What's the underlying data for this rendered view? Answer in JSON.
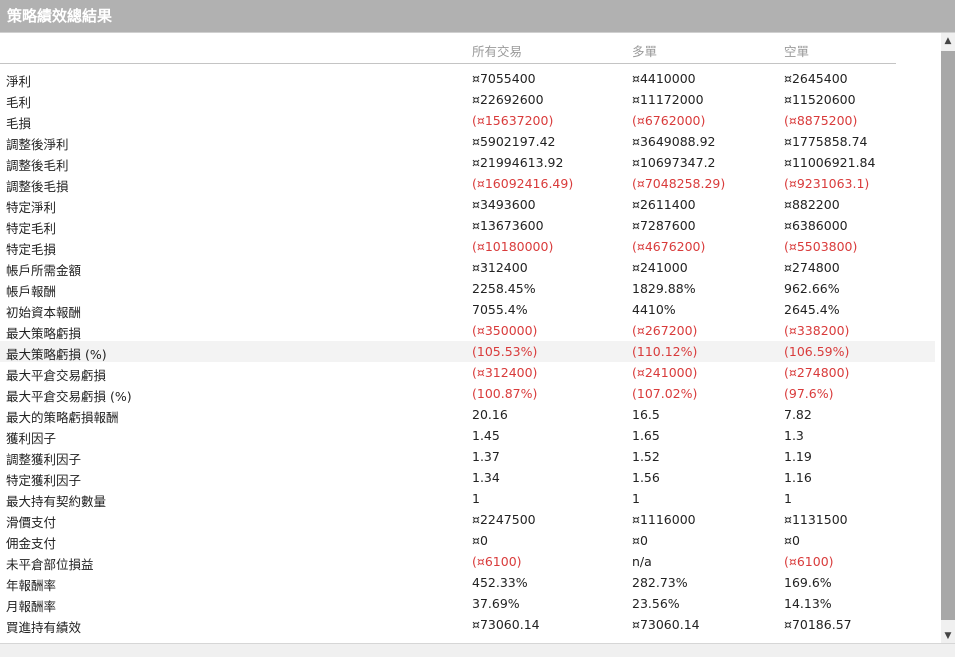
{
  "title": "策略績效總結果",
  "headers": [
    "所有交易",
    "多單",
    "空單"
  ],
  "rows": [
    {
      "label": "淨利",
      "v": [
        "¤7055400",
        "¤4410000",
        "¤2645400"
      ]
    },
    {
      "label": "毛利",
      "v": [
        "¤22692600",
        "¤11172000",
        "¤11520600"
      ]
    },
    {
      "label": "毛損",
      "v": [
        "(¤15637200)",
        "(¤6762000)",
        "(¤8875200)"
      ]
    },
    {
      "label": "調整後淨利",
      "v": [
        "¤5902197.42",
        "¤3649088.92",
        "¤1775858.74"
      ]
    },
    {
      "label": "調整後毛利",
      "v": [
        "¤21994613.92",
        "¤10697347.2",
        "¤11006921.84"
      ]
    },
    {
      "label": "調整後毛損",
      "v": [
        "(¤16092416.49)",
        "(¤7048258.29)",
        "(¤9231063.1)"
      ]
    },
    {
      "label": "特定淨利",
      "v": [
        "¤3493600",
        "¤2611400",
        "¤882200"
      ]
    },
    {
      "label": "特定毛利",
      "v": [
        "¤13673600",
        "¤7287600",
        "¤6386000"
      ]
    },
    {
      "label": "特定毛損",
      "v": [
        "(¤10180000)",
        "(¤4676200)",
        "(¤5503800)"
      ]
    },
    {
      "label": "帳戶所需金額",
      "v": [
        "¤312400",
        "¤241000",
        "¤274800"
      ]
    },
    {
      "label": "帳戶報酬",
      "v": [
        "2258.45%",
        "1829.88%",
        "962.66%"
      ]
    },
    {
      "label": "初始資本報酬",
      "v": [
        "7055.4%",
        "4410%",
        "2645.4%"
      ]
    },
    {
      "label": "最大策略虧損",
      "v": [
        "(¤350000)",
        "(¤267200)",
        "(¤338200)"
      ]
    },
    {
      "label": "最大策略虧損 (%)",
      "v": [
        "(105.53%)",
        "(110.12%)",
        "(106.59%)"
      ]
    },
    {
      "label": "最大平倉交易虧損",
      "v": [
        "(¤312400)",
        "(¤241000)",
        "(¤274800)"
      ]
    },
    {
      "label": "最大平倉交易虧損 (%)",
      "v": [
        "(100.87%)",
        "(107.02%)",
        "(97.6%)"
      ]
    },
    {
      "label": "最大的策略虧損報酬",
      "v": [
        "20.16",
        "16.5",
        "7.82"
      ]
    },
    {
      "label": "獲利因子",
      "v": [
        "1.45",
        "1.65",
        "1.3"
      ]
    },
    {
      "label": "調整獲利因子",
      "v": [
        "1.37",
        "1.52",
        "1.19"
      ]
    },
    {
      "label": "特定獲利因子",
      "v": [
        "1.34",
        "1.56",
        "1.16"
      ]
    },
    {
      "label": "最大持有契約數量",
      "v": [
        "1",
        "1",
        "1"
      ]
    },
    {
      "label": "滑價支付",
      "v": [
        "¤2247500",
        "¤1116000",
        "¤1131500"
      ]
    },
    {
      "label": "佣金支付",
      "v": [
        "¤0",
        "¤0",
        "¤0"
      ]
    },
    {
      "label": "未平倉部位損益",
      "v": [
        "(¤6100)",
        "n/a",
        "(¤6100)"
      ]
    },
    {
      "label": "年報酬率",
      "v": [
        "452.33%",
        "282.73%",
        "169.6%"
      ]
    },
    {
      "label": "月報酬率",
      "v": [
        "37.69%",
        "23.56%",
        "14.13%"
      ]
    },
    {
      "label": "買進持有績效",
      "v": [
        "¤73060.14",
        "¤73060.14",
        "¤70186.57"
      ]
    }
  ],
  "highlighted_row": 13,
  "colors": {
    "titlebar": "#b1b1b1",
    "negative": "#d93b3b",
    "header_text": "#9a9a9a",
    "highlight": "#f3f3f3"
  },
  "scrollbar": {
    "up_icon": "chevron-up-icon",
    "down_icon": "chevron-down-icon"
  }
}
